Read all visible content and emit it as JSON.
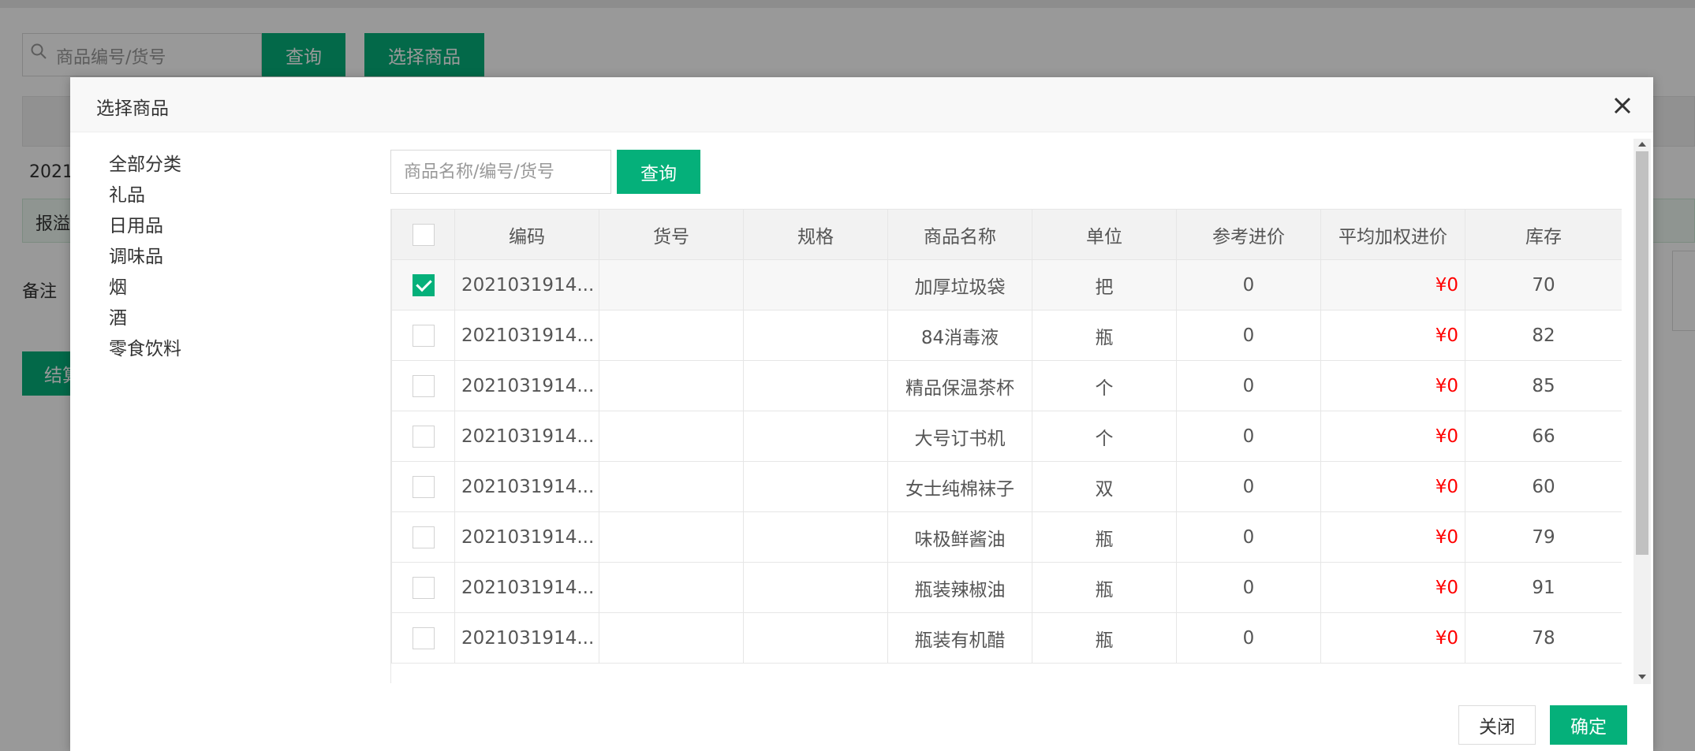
{
  "background": {
    "search_placeholder": "商品编号/货号",
    "query_label": "查询",
    "select_goods_label": "选择商品",
    "row_prefix": "2021",
    "alert_text": "报溢",
    "remark_label": "备注",
    "settle_label": "结算"
  },
  "modal": {
    "title": "选择商品",
    "categories": [
      "全部分类",
      "礼品",
      "日用品",
      "调味品",
      "烟",
      "酒",
      "零食饮料"
    ],
    "search_placeholder": "商品名称/编号/货号",
    "query_label": "查询",
    "columns": [
      "编码",
      "货号",
      "规格",
      "商品名称",
      "单位",
      "参考进价",
      "平均加权进价",
      "库存"
    ],
    "rows": [
      {
        "checked": true,
        "code": "2021031914...",
        "sku": "",
        "spec": "",
        "name": "加厚垃圾袋",
        "unit": "把",
        "ref_price": "0",
        "avg_price": "¥0",
        "stock": "70"
      },
      {
        "checked": false,
        "code": "2021031914...",
        "sku": "",
        "spec": "",
        "name": "84消毒液",
        "unit": "瓶",
        "ref_price": "0",
        "avg_price": "¥0",
        "stock": "82"
      },
      {
        "checked": false,
        "code": "2021031914...",
        "sku": "",
        "spec": "",
        "name": "精品保温茶杯",
        "unit": "个",
        "ref_price": "0",
        "avg_price": "¥0",
        "stock": "85"
      },
      {
        "checked": false,
        "code": "2021031914...",
        "sku": "",
        "spec": "",
        "name": "大号订书机",
        "unit": "个",
        "ref_price": "0",
        "avg_price": "¥0",
        "stock": "66"
      },
      {
        "checked": false,
        "code": "2021031914...",
        "sku": "",
        "spec": "",
        "name": "女士纯棉袜子",
        "unit": "双",
        "ref_price": "0",
        "avg_price": "¥0",
        "stock": "60"
      },
      {
        "checked": false,
        "code": "2021031914...",
        "sku": "",
        "spec": "",
        "name": "味极鲜酱油",
        "unit": "瓶",
        "ref_price": "0",
        "avg_price": "¥0",
        "stock": "79"
      },
      {
        "checked": false,
        "code": "2021031914...",
        "sku": "",
        "spec": "",
        "name": "瓶装辣椒油",
        "unit": "瓶",
        "ref_price": "0",
        "avg_price": "¥0",
        "stock": "91"
      },
      {
        "checked": false,
        "code": "2021031914...",
        "sku": "",
        "spec": "",
        "name": "瓶装有机醋",
        "unit": "瓶",
        "ref_price": "0",
        "avg_price": "¥0",
        "stock": "78"
      }
    ],
    "close_label": "关闭",
    "confirm_label": "确定"
  },
  "colors": {
    "accent": "#05b07a",
    "price": "#ff0000"
  },
  "icons": {
    "search": "search-icon",
    "close": "close-icon",
    "check": "check-icon"
  }
}
